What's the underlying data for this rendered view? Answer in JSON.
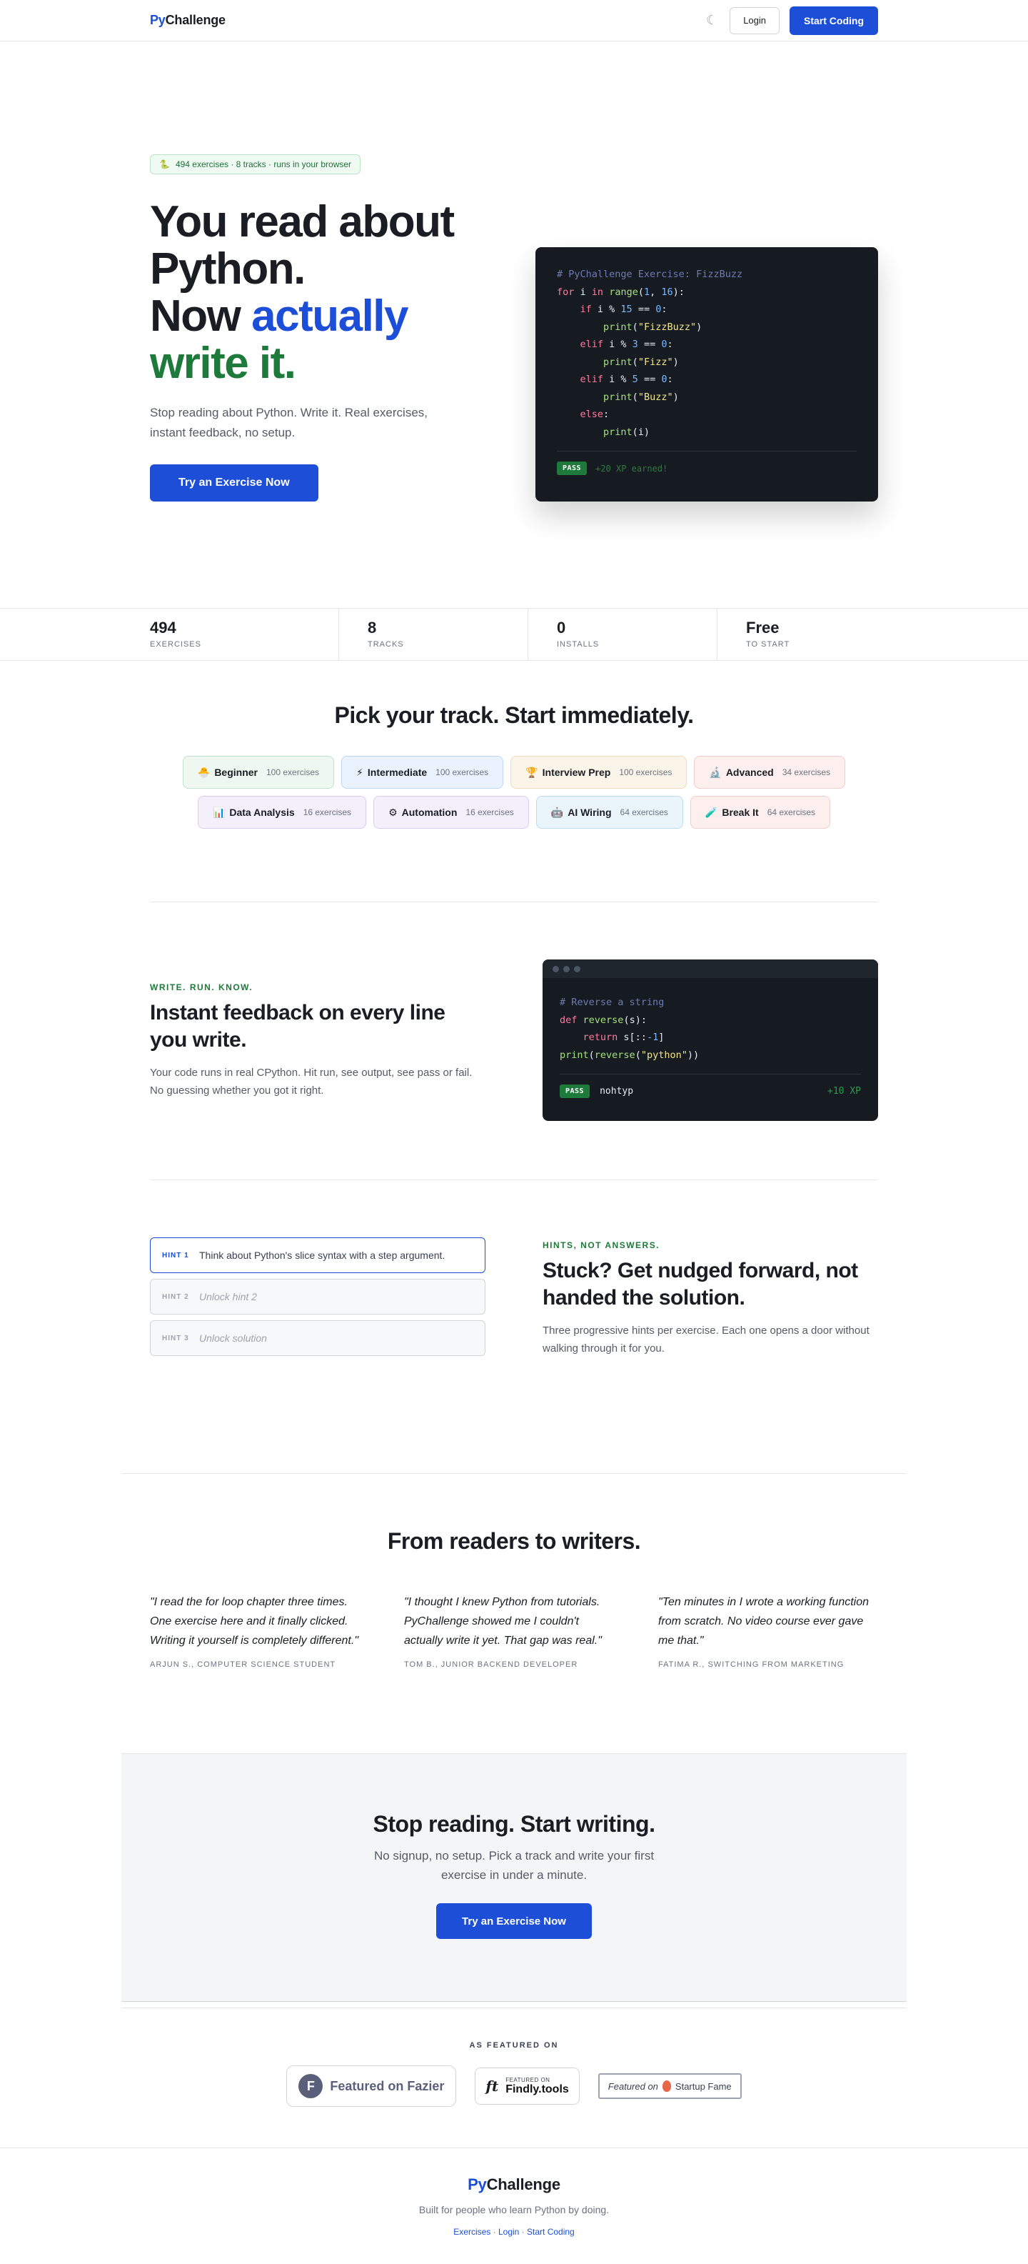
{
  "nav": {
    "logo_py": "Py",
    "logo_rest": "Challenge",
    "theme_icon": "moon-icon",
    "login_label": "Login",
    "cta_label": "Start Coding"
  },
  "hero": {
    "pill_icon": "snake-icon",
    "pill_text": "494 exercises · 8 tracks · runs in your browser",
    "title_line1": "You read about",
    "title_line2": "Python.",
    "title_now": "Now ",
    "title_actually": "actually",
    "title_write": "write it.",
    "subtitle": "Stop reading about Python. Write it. Real exercises, instant feedback, no setup.",
    "cta_label": "Try an Exercise Now",
    "code": {
      "comment": "# PyChallenge Exercise: FizzBuzz",
      "pass": "PASS",
      "xp": "+20 XP earned!"
    }
  },
  "stats": [
    {
      "value": "494",
      "label": "EXERCISES"
    },
    {
      "value": "8",
      "label": "TRACKS"
    },
    {
      "value": "0",
      "label": "INSTALLS"
    },
    {
      "value": "Free",
      "label": "TO START"
    }
  ],
  "tracks": {
    "title": "Pick your track. Start immediately.",
    "row1": [
      {
        "icon": "🐣",
        "name": "Beginner",
        "count": "100 exercises",
        "bg": "#eef8f0",
        "border": "#bfe3c8"
      },
      {
        "icon": "⚡",
        "name": "Intermediate",
        "count": "100 exercises",
        "bg": "#eaf3fd",
        "border": "#bcd7f3"
      },
      {
        "icon": "🏆",
        "name": "Interview Prep",
        "count": "100 exercises",
        "bg": "#fbf5e9",
        "border": "#eedcb8"
      },
      {
        "icon": "🔬",
        "name": "Advanced",
        "count": "34 exercises",
        "bg": "#fcefee",
        "border": "#efcfcb"
      }
    ],
    "row2": [
      {
        "icon": "📊",
        "name": "Data Analysis",
        "count": "16 exercises",
        "bg": "#f3effb",
        "border": "#d8cdef"
      },
      {
        "icon": "⚙",
        "name": "Automation",
        "count": "16 exercises",
        "bg": "#f3effb",
        "border": "#d8cdef"
      },
      {
        "icon": "🤖",
        "name": "AI Wiring",
        "count": "64 exercises",
        "bg": "#eaf5fb",
        "border": "#bcdcee"
      },
      {
        "icon": "🧪",
        "name": "Break It",
        "count": "64 exercises",
        "bg": "#fcefee",
        "border": "#efcfcb"
      }
    ]
  },
  "feature1": {
    "eyebrow": "WRITE. RUN. KNOW.",
    "title": "Instant feedback on every line you write.",
    "body": "Your code runs in real CPython. Hit run, see output, see pass or fail. No guessing whether you got it right.",
    "code_comment": "# Reverse a string",
    "pass": "PASS",
    "output": "nohtyp",
    "xp": "+10 XP"
  },
  "feature2": {
    "eyebrow": "HINTS, NOT ANSWERS.",
    "title": "Stuck? Get nudged forward, not handed the solution.",
    "body": "Three progressive hints per exercise. Each one opens a door without walking through it for you.",
    "hints": [
      {
        "tag": "HINT 1",
        "text": "Think about Python's slice syntax with a step argument."
      },
      {
        "tag": "HINT 2",
        "text": "Unlock hint 2"
      },
      {
        "tag": "HINT 3",
        "text": "Unlock solution"
      }
    ]
  },
  "testimonials": {
    "title": "From readers to writers.",
    "items": [
      {
        "quote": "\"I read the for loop chapter three times. One exercise here and it finally clicked. Writing it yourself is completely different.\"",
        "by": "ARJUN S., COMPUTER SCIENCE STUDENT"
      },
      {
        "quote": "\"I thought I knew Python from tutorials. PyChallenge showed me I couldn't actually write it yet. That gap was real.\"",
        "by": "TOM B., JUNIOR BACKEND DEVELOPER"
      },
      {
        "quote": "\"Ten minutes in I wrote a working function from scratch. No video course ever gave me that.\"",
        "by": "FATIMA R., SWITCHING FROM MARKETING"
      }
    ]
  },
  "cta": {
    "title": "Stop reading. Start writing.",
    "subtitle": "No signup, no setup. Pick a track and write your first exercise in under a minute.",
    "button": "Try an Exercise Now"
  },
  "featured": {
    "label": "AS FEATURED ON",
    "fazier_letter": "F",
    "fazier": "Featured on Fazier",
    "findly_logo": "ft",
    "findly_small": "FEATURED ON",
    "findly_big": "Findly.tools",
    "fame_prefix": "Featured on",
    "fame_name": "Startup Fame"
  },
  "footer": {
    "logo_py": "Py",
    "logo_rest": "Challenge",
    "tagline": "Built for people who learn Python by doing.",
    "links": [
      "Exercises",
      "Login",
      "Start Coding"
    ],
    "sep": " · "
  }
}
